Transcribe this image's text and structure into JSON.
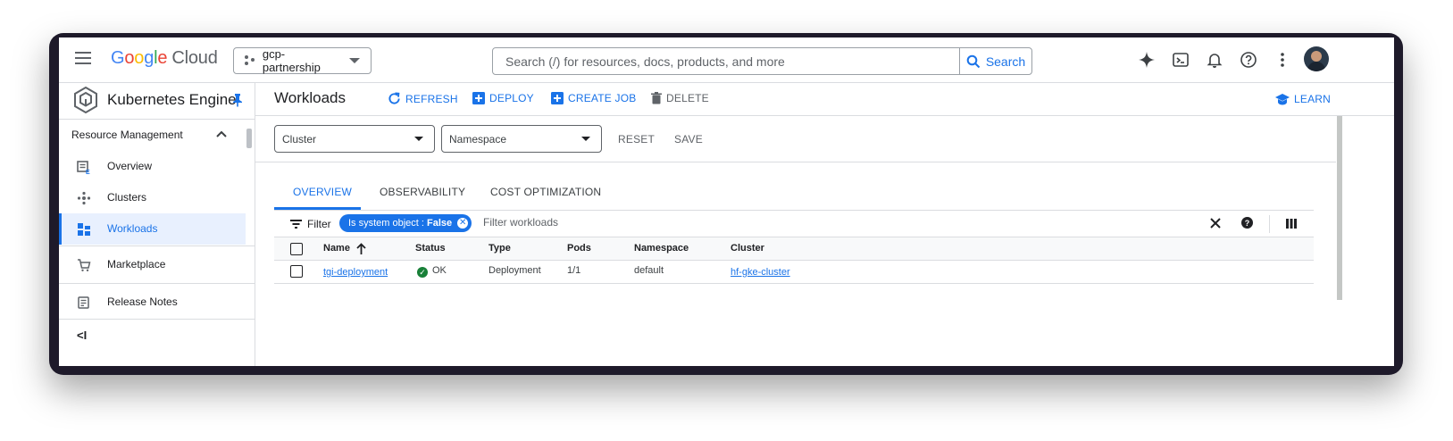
{
  "header": {
    "logo_google": [
      "G",
      "o",
      "o",
      "g",
      "l",
      "e"
    ],
    "logo_cloud": "Cloud",
    "project": "gcp-partnership",
    "search_placeholder": "Search (/) for resources, docs, products, and more",
    "search_button": "Search",
    "icons": [
      "gemini-icon",
      "cloud-shell-icon",
      "notifications-icon",
      "help-icon",
      "more-vert-icon",
      "avatar"
    ]
  },
  "sidebar": {
    "product_title": "Kubernetes Engine",
    "section_title": "Resource Management",
    "items": [
      {
        "label": "Overview",
        "icon": "overview-icon"
      },
      {
        "label": "Clusters",
        "icon": "clusters-icon"
      },
      {
        "label": "Workloads",
        "icon": "workloads-icon",
        "active": true
      }
    ],
    "extra_items": [
      {
        "label": "Marketplace",
        "icon": "marketplace-icon"
      },
      {
        "label": "Release Notes",
        "icon": "release-notes-icon"
      }
    ],
    "collapse_label": "<I"
  },
  "main": {
    "title": "Workloads",
    "actions": {
      "refresh": "REFRESH",
      "deploy": "DEPLOY",
      "create_job": "CREATE JOB",
      "delete": "DELETE",
      "learn": "LEARN"
    },
    "filters": {
      "cluster_placeholder": "Cluster",
      "namespace_placeholder": "Namespace",
      "reset": "RESET",
      "save": "SAVE"
    },
    "tabs": [
      "OVERVIEW",
      "OBSERVABILITY",
      "COST OPTIMIZATION"
    ],
    "filterbar": {
      "label": "Filter",
      "chip_key": "Is system object : ",
      "chip_value": "False",
      "placeholder": "Filter workloads"
    },
    "table": {
      "columns": [
        "Name",
        "Status",
        "Type",
        "Pods",
        "Namespace",
        "Cluster"
      ],
      "rows": [
        {
          "name": "tgi-deployment",
          "status": "OK",
          "type": "Deployment",
          "pods": "1/1",
          "namespace": "default",
          "cluster": "hf-gke-cluster"
        }
      ]
    }
  },
  "colors": {
    "accent": "#1a73e8",
    "ok": "#188038",
    "frame": "#1e1a2a"
  }
}
